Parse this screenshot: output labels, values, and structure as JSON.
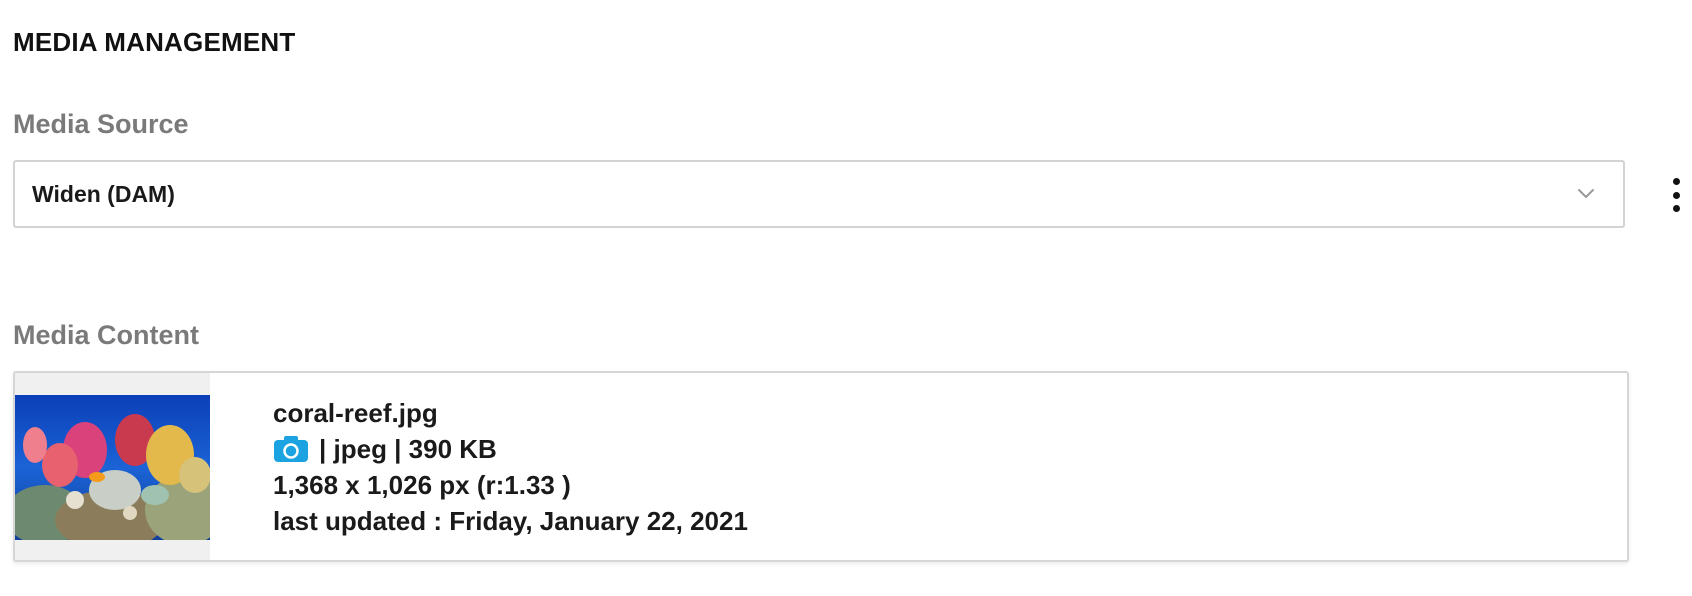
{
  "section": {
    "title": "MEDIA MANAGEMENT"
  },
  "media_source": {
    "label": "Media Source",
    "selected": "Widen (DAM)"
  },
  "media_content": {
    "label": "Media Content",
    "file_name": "coral-reef.jpg",
    "type_info": "| jpeg | 390 KB",
    "dimensions": "1,368 x 1,026 px (r:1.33 )",
    "last_updated": "last updated : Friday, January 22, 2021",
    "icon_color": "#1aa3e0"
  }
}
